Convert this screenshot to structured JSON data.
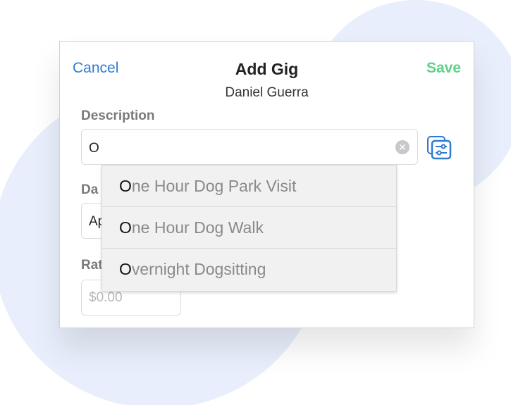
{
  "header": {
    "cancel_label": "Cancel",
    "title": "Add Gig",
    "subtitle": "Daniel Guerra",
    "save_label": "Save"
  },
  "colors": {
    "accent_blue": "#2f7bd1",
    "save_green": "#5dd08a"
  },
  "form": {
    "description": {
      "label": "Description",
      "value": "O",
      "clear_icon": "clear-circle-icon",
      "presets_icon": "presets-list-icon"
    },
    "date": {
      "label": "Da",
      "value": "Ap"
    },
    "rate": {
      "label": "Rat",
      "placeholder": "$0.00"
    }
  },
  "autocomplete": {
    "items": [
      {
        "match": "O",
        "rest": "ne Hour Dog Park Visit"
      },
      {
        "match": "O",
        "rest": "ne Hour Dog Walk"
      },
      {
        "match": "O",
        "rest": "vernight Dogsitting"
      }
    ]
  }
}
